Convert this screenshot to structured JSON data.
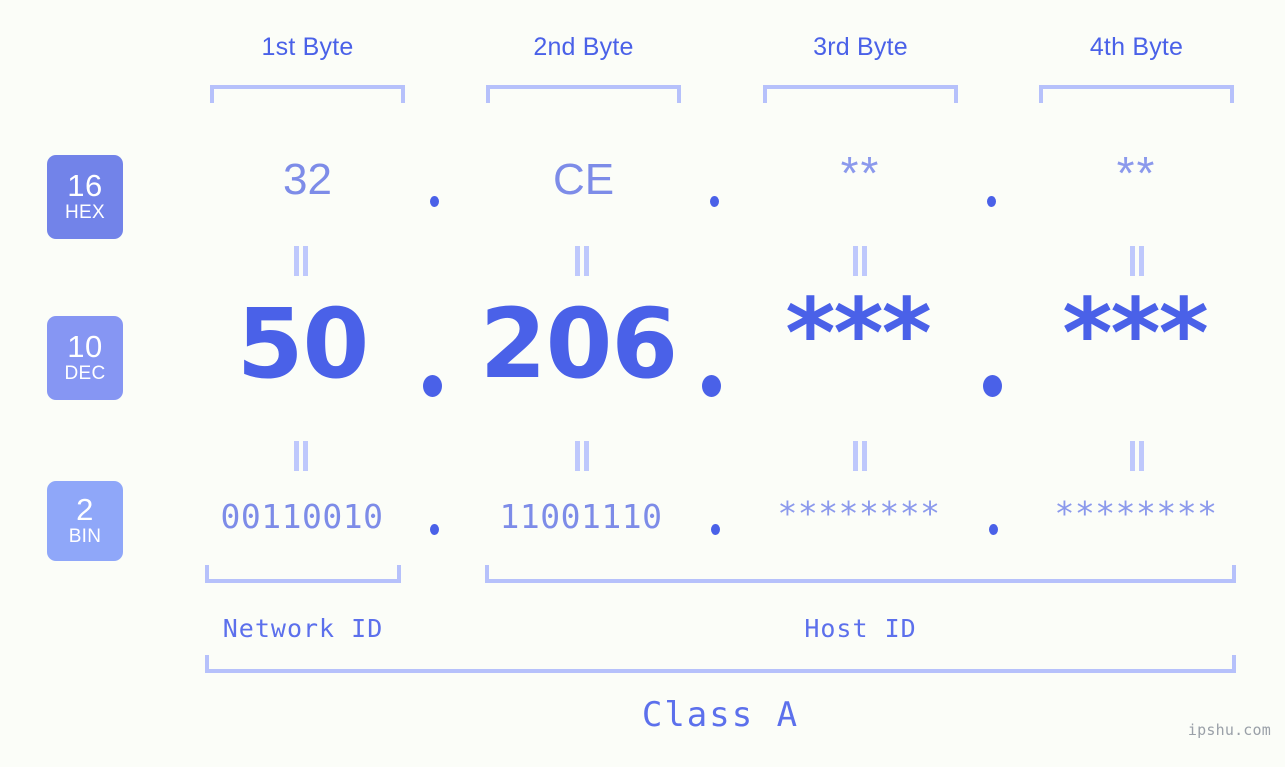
{
  "theme": {
    "background": "#fbfdf8",
    "accent_strong": "#4a61e8",
    "accent_mid": "#7d8ce8",
    "accent_light": "#b6c1fb",
    "badge_hex": "#7283e9",
    "badge_dec": "#8696f3",
    "badge_bin": "#8fa7f9",
    "watermark_color": "#9aa0a8"
  },
  "byte_headers": [
    {
      "label": "1st Byte"
    },
    {
      "label": "2nd Byte"
    },
    {
      "label": "3rd Byte"
    },
    {
      "label": "4th Byte"
    }
  ],
  "rows": [
    {
      "id": "hex",
      "badge_number": "16",
      "badge_name": "HEX",
      "values": [
        "32",
        "CE",
        "**",
        "**"
      ],
      "separator": "."
    },
    {
      "id": "dec",
      "badge_number": "10",
      "badge_name": "DEC",
      "values": [
        "50",
        "206",
        "***",
        "***"
      ],
      "separator": "."
    },
    {
      "id": "bin",
      "badge_number": "2",
      "badge_name": "BIN",
      "values": [
        "00110010",
        "11001110",
        "********",
        "********"
      ],
      "separator": "."
    }
  ],
  "equality_symbol": "=",
  "sections": [
    {
      "label": "Network ID"
    },
    {
      "label": "Host ID"
    }
  ],
  "class": {
    "label": "Class A"
  },
  "watermark": {
    "text": "ipshu.com"
  }
}
